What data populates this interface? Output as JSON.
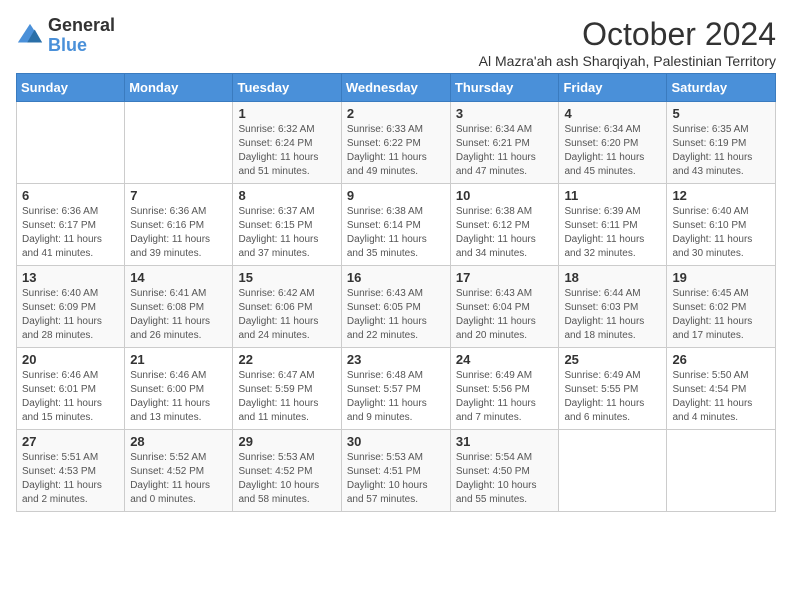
{
  "logo": {
    "general": "General",
    "blue": "Blue"
  },
  "header": {
    "month": "October 2024",
    "subtitle": "Al Mazra'ah ash Sharqiyah, Palestinian Territory"
  },
  "weekdays": [
    "Sunday",
    "Monday",
    "Tuesday",
    "Wednesday",
    "Thursday",
    "Friday",
    "Saturday"
  ],
  "weeks": [
    [
      {
        "day": "",
        "sunrise": "",
        "sunset": "",
        "daylight": ""
      },
      {
        "day": "",
        "sunrise": "",
        "sunset": "",
        "daylight": ""
      },
      {
        "day": "1",
        "sunrise": "Sunrise: 6:32 AM",
        "sunset": "Sunset: 6:24 PM",
        "daylight": "Daylight: 11 hours and 51 minutes."
      },
      {
        "day": "2",
        "sunrise": "Sunrise: 6:33 AM",
        "sunset": "Sunset: 6:22 PM",
        "daylight": "Daylight: 11 hours and 49 minutes."
      },
      {
        "day": "3",
        "sunrise": "Sunrise: 6:34 AM",
        "sunset": "Sunset: 6:21 PM",
        "daylight": "Daylight: 11 hours and 47 minutes."
      },
      {
        "day": "4",
        "sunrise": "Sunrise: 6:34 AM",
        "sunset": "Sunset: 6:20 PM",
        "daylight": "Daylight: 11 hours and 45 minutes."
      },
      {
        "day": "5",
        "sunrise": "Sunrise: 6:35 AM",
        "sunset": "Sunset: 6:19 PM",
        "daylight": "Daylight: 11 hours and 43 minutes."
      }
    ],
    [
      {
        "day": "6",
        "sunrise": "Sunrise: 6:36 AM",
        "sunset": "Sunset: 6:17 PM",
        "daylight": "Daylight: 11 hours and 41 minutes."
      },
      {
        "day": "7",
        "sunrise": "Sunrise: 6:36 AM",
        "sunset": "Sunset: 6:16 PM",
        "daylight": "Daylight: 11 hours and 39 minutes."
      },
      {
        "day": "8",
        "sunrise": "Sunrise: 6:37 AM",
        "sunset": "Sunset: 6:15 PM",
        "daylight": "Daylight: 11 hours and 37 minutes."
      },
      {
        "day": "9",
        "sunrise": "Sunrise: 6:38 AM",
        "sunset": "Sunset: 6:14 PM",
        "daylight": "Daylight: 11 hours and 35 minutes."
      },
      {
        "day": "10",
        "sunrise": "Sunrise: 6:38 AM",
        "sunset": "Sunset: 6:12 PM",
        "daylight": "Daylight: 11 hours and 34 minutes."
      },
      {
        "day": "11",
        "sunrise": "Sunrise: 6:39 AM",
        "sunset": "Sunset: 6:11 PM",
        "daylight": "Daylight: 11 hours and 32 minutes."
      },
      {
        "day": "12",
        "sunrise": "Sunrise: 6:40 AM",
        "sunset": "Sunset: 6:10 PM",
        "daylight": "Daylight: 11 hours and 30 minutes."
      }
    ],
    [
      {
        "day": "13",
        "sunrise": "Sunrise: 6:40 AM",
        "sunset": "Sunset: 6:09 PM",
        "daylight": "Daylight: 11 hours and 28 minutes."
      },
      {
        "day": "14",
        "sunrise": "Sunrise: 6:41 AM",
        "sunset": "Sunset: 6:08 PM",
        "daylight": "Daylight: 11 hours and 26 minutes."
      },
      {
        "day": "15",
        "sunrise": "Sunrise: 6:42 AM",
        "sunset": "Sunset: 6:06 PM",
        "daylight": "Daylight: 11 hours and 24 minutes."
      },
      {
        "day": "16",
        "sunrise": "Sunrise: 6:43 AM",
        "sunset": "Sunset: 6:05 PM",
        "daylight": "Daylight: 11 hours and 22 minutes."
      },
      {
        "day": "17",
        "sunrise": "Sunrise: 6:43 AM",
        "sunset": "Sunset: 6:04 PM",
        "daylight": "Daylight: 11 hours and 20 minutes."
      },
      {
        "day": "18",
        "sunrise": "Sunrise: 6:44 AM",
        "sunset": "Sunset: 6:03 PM",
        "daylight": "Daylight: 11 hours and 18 minutes."
      },
      {
        "day": "19",
        "sunrise": "Sunrise: 6:45 AM",
        "sunset": "Sunset: 6:02 PM",
        "daylight": "Daylight: 11 hours and 17 minutes."
      }
    ],
    [
      {
        "day": "20",
        "sunrise": "Sunrise: 6:46 AM",
        "sunset": "Sunset: 6:01 PM",
        "daylight": "Daylight: 11 hours and 15 minutes."
      },
      {
        "day": "21",
        "sunrise": "Sunrise: 6:46 AM",
        "sunset": "Sunset: 6:00 PM",
        "daylight": "Daylight: 11 hours and 13 minutes."
      },
      {
        "day": "22",
        "sunrise": "Sunrise: 6:47 AM",
        "sunset": "Sunset: 5:59 PM",
        "daylight": "Daylight: 11 hours and 11 minutes."
      },
      {
        "day": "23",
        "sunrise": "Sunrise: 6:48 AM",
        "sunset": "Sunset: 5:57 PM",
        "daylight": "Daylight: 11 hours and 9 minutes."
      },
      {
        "day": "24",
        "sunrise": "Sunrise: 6:49 AM",
        "sunset": "Sunset: 5:56 PM",
        "daylight": "Daylight: 11 hours and 7 minutes."
      },
      {
        "day": "25",
        "sunrise": "Sunrise: 6:49 AM",
        "sunset": "Sunset: 5:55 PM",
        "daylight": "Daylight: 11 hours and 6 minutes."
      },
      {
        "day": "26",
        "sunrise": "Sunrise: 5:50 AM",
        "sunset": "Sunset: 4:54 PM",
        "daylight": "Daylight: 11 hours and 4 minutes."
      }
    ],
    [
      {
        "day": "27",
        "sunrise": "Sunrise: 5:51 AM",
        "sunset": "Sunset: 4:53 PM",
        "daylight": "Daylight: 11 hours and 2 minutes."
      },
      {
        "day": "28",
        "sunrise": "Sunrise: 5:52 AM",
        "sunset": "Sunset: 4:52 PM",
        "daylight": "Daylight: 11 hours and 0 minutes."
      },
      {
        "day": "29",
        "sunrise": "Sunrise: 5:53 AM",
        "sunset": "Sunset: 4:52 PM",
        "daylight": "Daylight: 10 hours and 58 minutes."
      },
      {
        "day": "30",
        "sunrise": "Sunrise: 5:53 AM",
        "sunset": "Sunset: 4:51 PM",
        "daylight": "Daylight: 10 hours and 57 minutes."
      },
      {
        "day": "31",
        "sunrise": "Sunrise: 5:54 AM",
        "sunset": "Sunset: 4:50 PM",
        "daylight": "Daylight: 10 hours and 55 minutes."
      },
      {
        "day": "",
        "sunrise": "",
        "sunset": "",
        "daylight": ""
      },
      {
        "day": "",
        "sunrise": "",
        "sunset": "",
        "daylight": ""
      }
    ]
  ]
}
